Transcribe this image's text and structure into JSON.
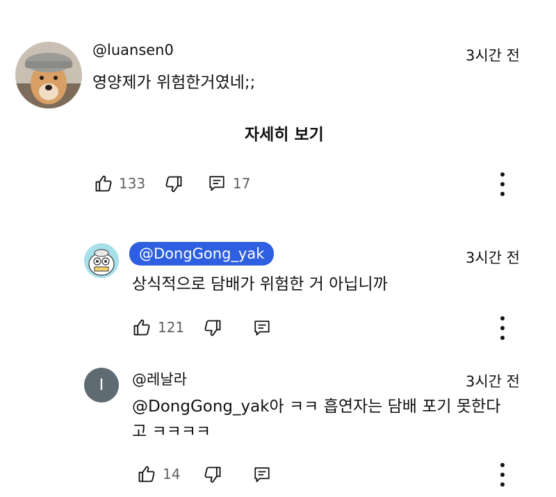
{
  "comment": {
    "author": "@luansen0",
    "time": "3시간 전",
    "text": "영양제가 위험한거였네;;",
    "show_more": "자세히 보기",
    "likes": "133",
    "replies_count": "17"
  },
  "replies": [
    {
      "author": "@DongGong_yak",
      "time": "3시간 전",
      "text": "상식적으로 담배가 위험한 거 아닙니까",
      "likes": "121"
    },
    {
      "author": "@레날라",
      "avatar_letter": "I",
      "time": "3시간 전",
      "text_line1": "@DongGong_yak아 ㅋㅋ 흡연자는 담배 포기 못한다",
      "text_line2": "고 ㅋㅋㅋㅋ",
      "likes": "14"
    }
  ],
  "icons": {
    "like": "thumb-up-icon",
    "dislike": "thumb-down-icon",
    "reply": "comment-icon",
    "more": "more-vert-icon"
  },
  "colors": {
    "chip_bg": "#2d5fe0",
    "avatar_grey": "#5f6b73",
    "text": "#0f0f0f",
    "secondary": "#606060"
  }
}
